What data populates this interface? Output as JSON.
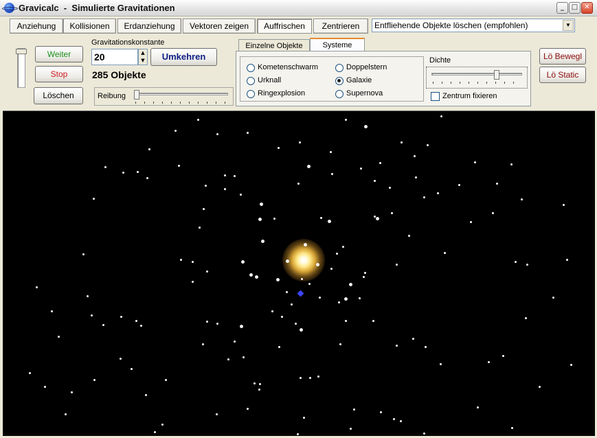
{
  "window": {
    "title": "Gravicalc  -  Simulierte Gravitationen",
    "minimize": "_",
    "maximize": "□",
    "close": "✕"
  },
  "toolbar": {
    "tabs": [
      "Anziehung",
      "Kollisionen",
      "Erdanziehung",
      "Vektoren zeigen",
      "Auffrischen",
      "Zentrieren"
    ],
    "dropdown_value": "Entfliehende Objekte löschen (empfohlen)",
    "dropdown_arrow": "▼"
  },
  "controls": {
    "weiter": "Weiter",
    "stop": "Stop",
    "loeschen": "Löschen",
    "gravitation_label": "Gravitationskonstante",
    "gravitation_value": "20",
    "spin_up": "▲",
    "spin_down": "▼",
    "umkehren": "Umkehren",
    "object_count": "285 Objekte",
    "reibung_label": "Reibung"
  },
  "panel": {
    "tabs": [
      "Einzelne Objekte",
      "Systeme"
    ],
    "active_tab": "Systeme",
    "options": [
      {
        "label": "Kometenschwarm",
        "checked": false
      },
      {
        "label": "Urknall",
        "checked": false
      },
      {
        "label": "Ringexplosion",
        "checked": false
      },
      {
        "label": "Doppelstern",
        "checked": false
      },
      {
        "label": "Galaxie",
        "checked": true
      },
      {
        "label": "Supernova",
        "checked": false
      }
    ],
    "dichte_label": "Dichte",
    "zentrum_label": "Zentrum fixieren",
    "zentrum_checked": false
  },
  "side_buttons": {
    "lo_bewegl": "Lö Bewegl",
    "lo_static": "Lö Static"
  },
  "colors": {
    "window_bg": "#ece9d8",
    "canvas_bg": "#000000",
    "weiter_text": "#1a8f1a",
    "stop_text": "#cc1b1b",
    "umkehren_text": "#0d1e86",
    "side_button_text": "#8a0b0b",
    "highlight_object": "#3b43ff"
  }
}
